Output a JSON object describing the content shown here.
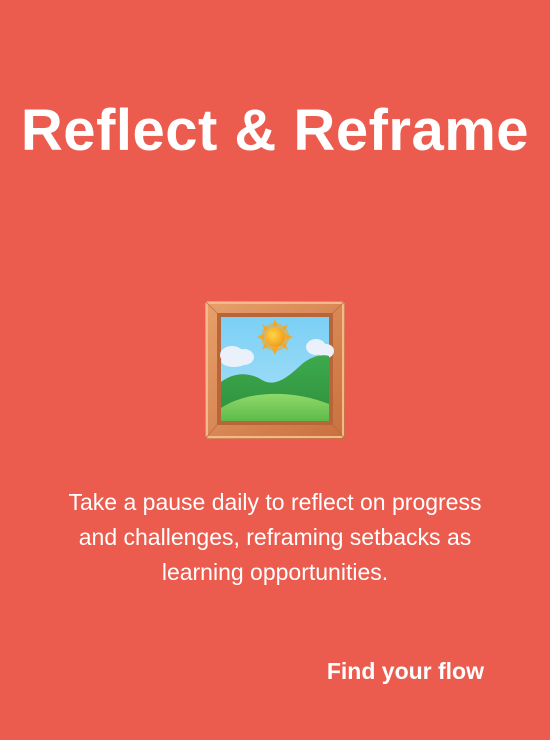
{
  "card": {
    "title": "Reflect & Reframe",
    "illustration_icon": "framed-picture-icon",
    "description": "Take a pause daily to reflect on progress and challenges, reframing setbacks as learning opportunities.",
    "cta_label": "Find your flow"
  },
  "colors": {
    "background": "#EB5C4F",
    "text": "#FFFFFF",
    "frame": "#D9824F",
    "sky": "#6EC6F0",
    "hills": "#3FAE52",
    "sun": "#F6B325"
  }
}
